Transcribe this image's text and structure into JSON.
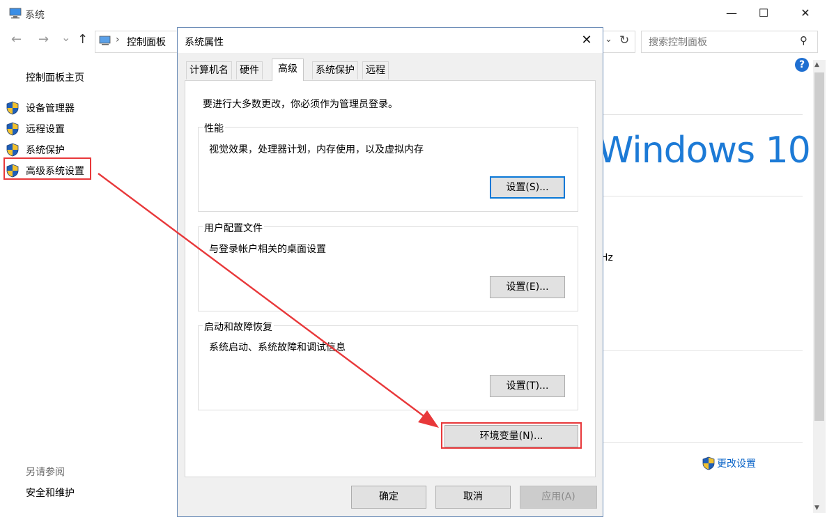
{
  "window": {
    "title": "系统"
  },
  "address_bar": {
    "crumb": "控制面板",
    "separator": "›"
  },
  "search": {
    "placeholder": "搜索控制面板"
  },
  "sidebar": {
    "home": "控制面板主页",
    "items": [
      {
        "label": "设备管理器"
      },
      {
        "label": "远程设置"
      },
      {
        "label": "系统保护"
      },
      {
        "label": "高级系统设置"
      }
    ],
    "see_also_title": "另请参阅",
    "see_also_items": [
      {
        "label": "安全和维护"
      }
    ]
  },
  "main": {
    "brand_text": "Windows 10",
    "partial_text": "Hz",
    "change_settings": "更改设置"
  },
  "dialog": {
    "title": "系统属性",
    "tabs": [
      {
        "label": "计算机名"
      },
      {
        "label": "硬件"
      },
      {
        "label": "高级"
      },
      {
        "label": "系统保护"
      },
      {
        "label": "远程"
      }
    ],
    "note": "要进行大多数更改，你必须作为管理员登录。",
    "groups": [
      {
        "label": "性能",
        "desc": "视觉效果，处理器计划，内存使用，以及虚拟内存",
        "button": "设置(S)..."
      },
      {
        "label": "用户配置文件",
        "desc": "与登录帐户相关的桌面设置",
        "button": "设置(E)..."
      },
      {
        "label": "启动和故障恢复",
        "desc": "系统启动、系统故障和调试信息",
        "button": "设置(T)..."
      }
    ],
    "env_button": "环境变量(N)...",
    "ok": "确定",
    "cancel": "取消",
    "apply": "应用(A)"
  },
  "icons": {
    "shield": "uac-shield-icon",
    "back": "←",
    "forward": "→",
    "dropdown": "⌄",
    "up": "↑",
    "refresh": "↻",
    "search": "⚲",
    "help": "?",
    "minimize": "—",
    "maximize": "☐",
    "close": "✕"
  },
  "colors": {
    "accent_blue": "#1c7ad6",
    "annotation_red": "#e8383a",
    "link_blue": "#0a64c8",
    "focus_blue": "#0a78d7"
  }
}
